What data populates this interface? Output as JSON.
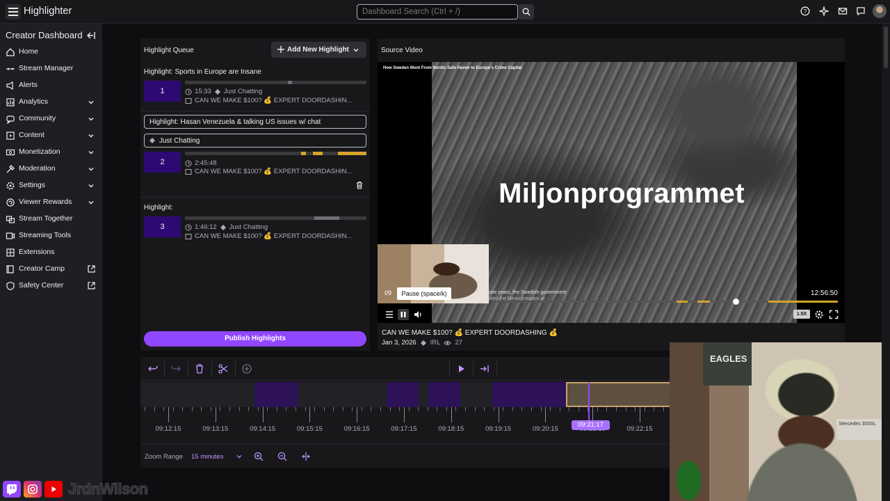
{
  "app": {
    "title": "Highlighter"
  },
  "search": {
    "placeholder": "Dashboard Search (Ctrl + /)"
  },
  "sidebar": {
    "title": "Creator Dashboard",
    "items": [
      {
        "label": "Home",
        "icon": "home-icon",
        "expandable": false
      },
      {
        "label": "Stream Manager",
        "icon": "stream-manager-icon",
        "expandable": false
      },
      {
        "label": "Alerts",
        "icon": "alerts-icon",
        "expandable": false
      },
      {
        "label": "Analytics",
        "icon": "analytics-icon",
        "expandable": true
      },
      {
        "label": "Community",
        "icon": "community-icon",
        "expandable": true
      },
      {
        "label": "Content",
        "icon": "content-icon",
        "expandable": true
      },
      {
        "label": "Monetization",
        "icon": "monetization-icon",
        "expandable": true
      },
      {
        "label": "Moderation",
        "icon": "moderation-icon",
        "expandable": true
      },
      {
        "label": "Settings",
        "icon": "settings-icon",
        "expandable": true
      },
      {
        "label": "Viewer Rewards",
        "icon": "viewer-rewards-icon",
        "expandable": true
      },
      {
        "label": "Stream Together",
        "icon": "stream-together-icon",
        "expandable": false
      },
      {
        "label": "Streaming Tools",
        "icon": "streaming-tools-icon",
        "expandable": false
      },
      {
        "label": "Extensions",
        "icon": "extensions-icon",
        "expandable": false
      },
      {
        "label": "Creator Camp",
        "icon": "creator-camp-icon",
        "external": true
      },
      {
        "label": "Safety Center",
        "icon": "safety-center-icon",
        "external": true
      }
    ]
  },
  "queue": {
    "title": "Highlight Queue",
    "add_button": "Add New Highlight",
    "publish_button": "Publish Highlights",
    "highlights": [
      {
        "title": "Highlight: Sports in Europe are Insane",
        "number": "1",
        "duration": "15:33",
        "category": "Just Chatting",
        "stream_title": "CAN WE MAKE $100? 💰 EXPERT DOORDASHIN..."
      },
      {
        "title_field": "Highlight: Hasan Venezuela & talking US issues w/ chat",
        "category_field": "Just Chatting",
        "number": "2",
        "duration": "2:45:48",
        "stream_title": "CAN WE MAKE $100? 💰 EXPERT DOORDASHIN..."
      },
      {
        "title": "Highlight:",
        "number": "3",
        "duration": "1:46:12",
        "category": "Just Chatting",
        "stream_title": "CAN WE MAKE $100? 💰 EXPERT DOORDASHIN..."
      }
    ]
  },
  "source": {
    "title": "Source Video",
    "video_heading": "How Sweden Went From Nordic Safe Haven to Europe's Crime Capital",
    "overlay_text": "Miljonprogrammet",
    "subtitle_line1": "ose years, the Swedish government",
    "subtitle_line2": "oled the Meon program at",
    "timestamp": "12:56:50",
    "pip_partial_time": "09",
    "tooltip": "Pause (space/k)",
    "speed": "1.5X",
    "seek_progress": 0.7,
    "stream_title": "CAN WE MAKE $100? 💰 EXPERT DOORDASHING 💰",
    "date": "Jan 3, 2026",
    "category": "IRL",
    "viewers": "27"
  },
  "timeline": {
    "tick_labels": [
      "09:12:15",
      "09:13:15",
      "09:14:15",
      "09:15:15",
      "09:16:15",
      "09:17:15",
      "09:18:15",
      "09:19:15",
      "09:20:15",
      "09:21:15",
      "09:22:15"
    ],
    "cursor_time": "09:21:17",
    "zoom_label": "Zoom Range",
    "zoom_value": "15 minutes"
  },
  "webcam": {
    "poster_text": "EAGLES",
    "shelf_text": "Mercedes 300SL"
  },
  "socials": {
    "handle": "JrdnWilson"
  },
  "colors": {
    "accent": "#9147ff",
    "highlight_block": "#2d0a73",
    "clip_segment": "#d6a32b"
  }
}
